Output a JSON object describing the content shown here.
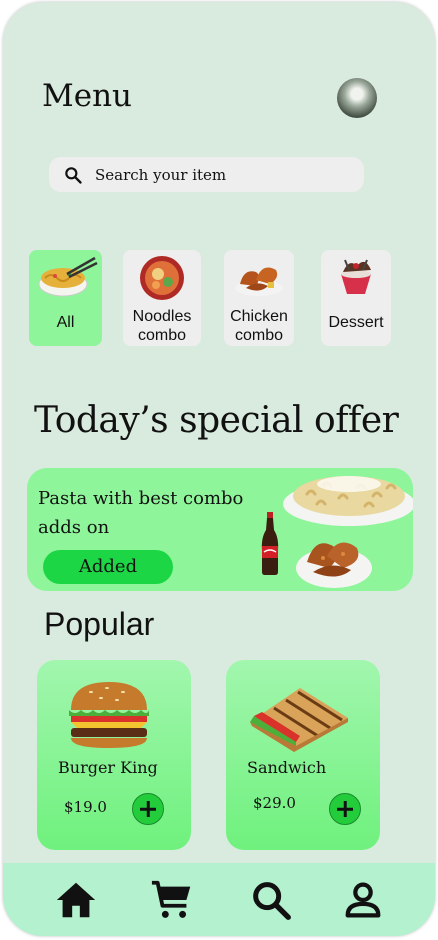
{
  "header": {
    "title": "Menu"
  },
  "search": {
    "placeholder": "Search your item"
  },
  "categories": [
    {
      "label": "All",
      "active": true
    },
    {
      "label": "Noodles combo",
      "active": false
    },
    {
      "label": "Chicken combo",
      "active": false
    },
    {
      "label": "Dessert",
      "active": false
    }
  ],
  "special": {
    "heading": "Today’s special offer",
    "description": "Pasta with best combo adds on",
    "button_label": "Added"
  },
  "popular": {
    "heading": "Popular",
    "items": [
      {
        "name": "Burger King",
        "price": "$19.0"
      },
      {
        "name": "Sandwich",
        "price": "$29.0"
      }
    ]
  },
  "nav": {
    "items": [
      {
        "icon": "home-icon"
      },
      {
        "icon": "cart-icon"
      },
      {
        "icon": "search-icon"
      },
      {
        "icon": "profile-icon"
      }
    ]
  },
  "colors": {
    "background": "#d9ebdf",
    "accent": "#8ef59a",
    "button": "#1dd645",
    "tabbar": "#b4f1cf"
  }
}
